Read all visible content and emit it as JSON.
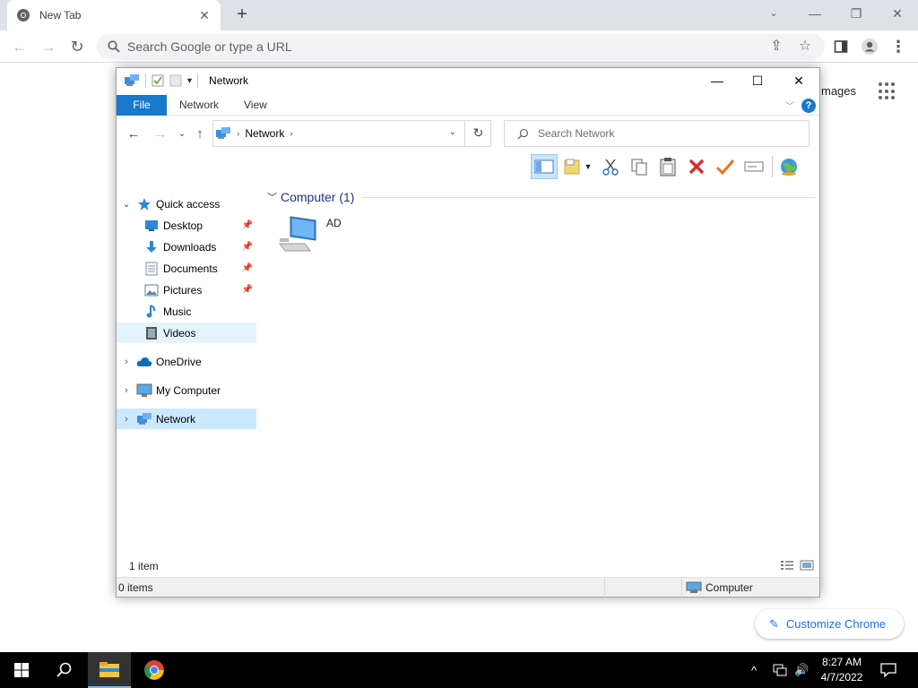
{
  "chrome": {
    "tab_title": "New Tab",
    "omnibox_placeholder": "Search Google or type a URL",
    "images_link": "mages",
    "customize_label": "Customize Chrome"
  },
  "explorer": {
    "title": "Network",
    "ribbon_tabs": [
      "File",
      "Network",
      "View"
    ],
    "address_crumb": "Network",
    "search_placeholder": "Search Network",
    "nav": {
      "quick_access": "Quick access",
      "desktop": "Desktop",
      "downloads": "Downloads",
      "documents": "Documents",
      "pictures": "Pictures",
      "music": "Music",
      "videos": "Videos",
      "onedrive": "OneDrive",
      "my_computer": "My Computer",
      "network": "Network"
    },
    "group_label": "Computer (1)",
    "items": [
      {
        "name": "AD",
        "icon": "computer-icon"
      }
    ],
    "item_count": "1 item",
    "status_left": "0 items",
    "status_right": "Computer"
  },
  "taskbar": {
    "time": "8:27 AM",
    "date": "4/7/2022"
  },
  "colors": {
    "file_tab": "#1979ca",
    "selection": "#cce8ff",
    "group_text": "#1e3287"
  }
}
